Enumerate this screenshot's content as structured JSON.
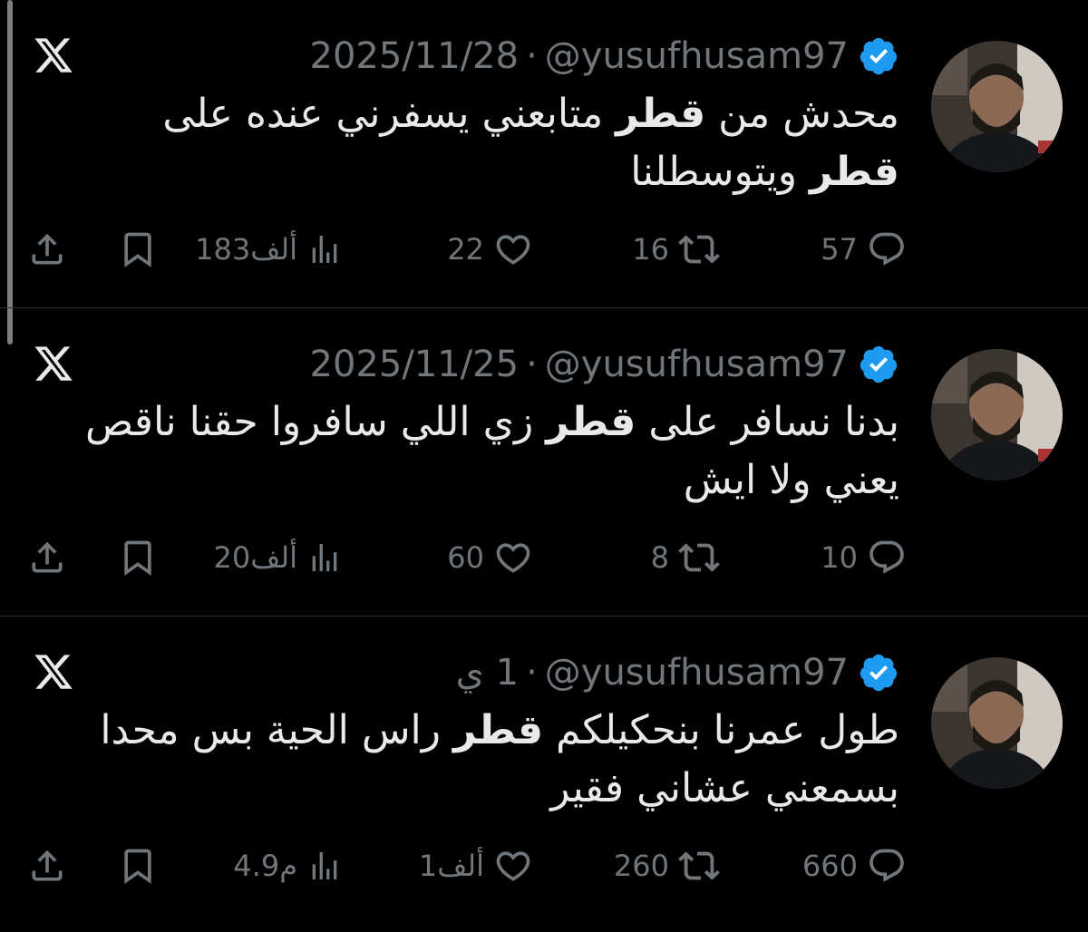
{
  "colors": {
    "background": "#000000",
    "text": "#e7e9ea",
    "muted": "#71767b",
    "verified": "#1d9bf0",
    "divider": "#2f3336"
  },
  "icons": {
    "platform": "x-logo-icon",
    "verified": "verified-badge-icon",
    "reply": "reply-icon",
    "retweet": "retweet-icon",
    "like": "heart-icon",
    "views": "views-icon",
    "bookmark": "bookmark-icon",
    "share": "share-icon"
  },
  "tweets": [
    {
      "handle": "@yusufhusam97",
      "separator": "·",
      "date": "2025/11/28",
      "text_parts": [
        "محدش من ",
        "قطر",
        " متابعني يسفرني عنده على ",
        "قطر",
        " ويتوسطلنا"
      ],
      "replies": "57",
      "retweets": "16",
      "likes": "22",
      "views": "183ألف"
    },
    {
      "handle": "@yusufhusam97",
      "separator": "·",
      "date": "2025/11/25",
      "text_parts": [
        "بدنا نسافر على ",
        "قطر",
        " زي اللي سافروا حقنا ناقص يعني ولا ايش"
      ],
      "replies": "10",
      "retweets": "8",
      "likes": "60",
      "views": "20ألف"
    },
    {
      "handle": "@yusufhusam97",
      "separator": "·",
      "date": "1 ي",
      "text_parts": [
        "طول عمرنا بنحكيلكم ",
        "قطر",
        " راس الحية بس محدا بسمعني عشاني فقير"
      ],
      "replies": "660",
      "retweets": "260",
      "likes": "1ألف",
      "views": "4.9م"
    }
  ]
}
